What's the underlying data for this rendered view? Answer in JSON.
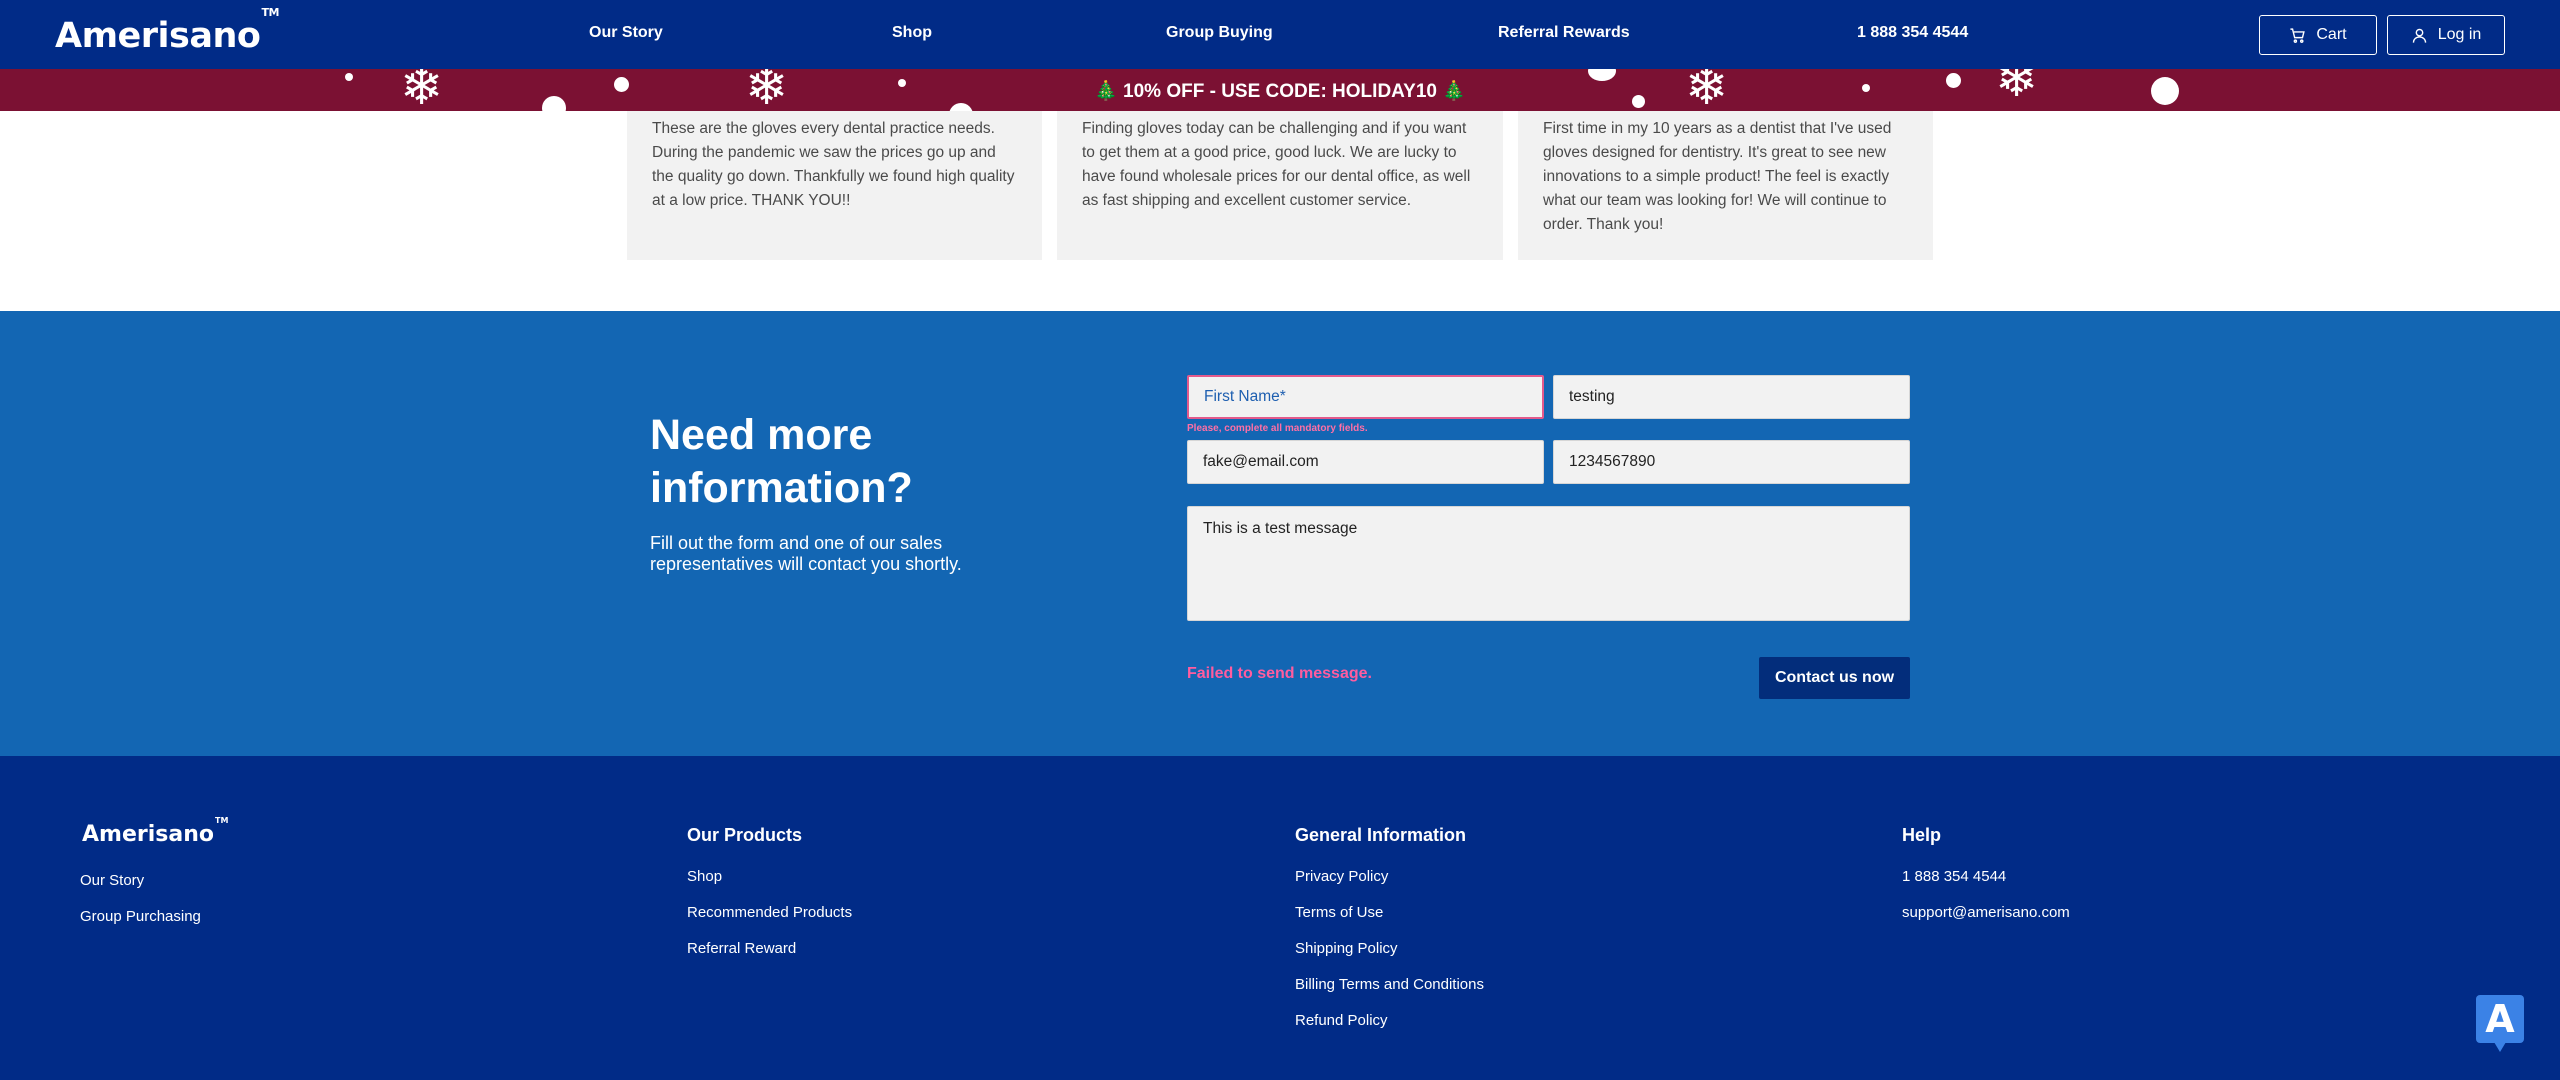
{
  "header": {
    "logo": "Amerisano",
    "logo_tm": "TM",
    "nav": [
      "Our Story",
      "Shop",
      "Group Buying",
      "Referral Rewards",
      "1 888 354 4544"
    ],
    "cart_label": "Cart",
    "login_label": "Log in"
  },
  "promo": {
    "text": "🎄 10% OFF - USE CODE: HOLIDAY10 🎄"
  },
  "testimonials": [
    {
      "text": "These are the gloves every dental practice needs. During the pandemic we saw the prices go up and the quality go down. Thankfully we found high quality at a low price. THANK YOU!!"
    },
    {
      "text": "Finding gloves today can be challenging and if you want to get them at a good price, good luck. We are lucky to have found wholesale prices for our dental office, as well as fast shipping and excellent customer service."
    },
    {
      "text": "First time in my 10 years as a dentist that I've used gloves designed for dentistry. It's great to see new innovations to a simple product! The feel is exactly what our team was looking for! We will continue to order. Thank you!"
    }
  ],
  "contact": {
    "title": "Need more information?",
    "description": "Fill out the form and one of our sales representatives will contact you shortly.",
    "first_name_placeholder": "First Name*",
    "last_name_value": "testing",
    "email_value": "fake@email.com",
    "phone_value": "1234567890",
    "message_value": "This is a test message",
    "error_text": "Please, complete all mandatory fields.",
    "fail_text": "Failed to send message.",
    "submit_label": "Contact us now"
  },
  "footer": {
    "logo": "Amerisano",
    "logo_tm": "TM",
    "col1_links": [
      "Our Story",
      "Group Purchasing"
    ],
    "products_heading": "Our Products",
    "products_links": [
      "Shop",
      "Recommended Products",
      "Referral Reward"
    ],
    "general_heading": "General Information",
    "general_links": [
      "Privacy Policy",
      "Terms of Use",
      "Shipping Policy",
      "Billing Terms and Conditions",
      "Refund Policy"
    ],
    "help_heading": "Help",
    "help_links": [
      "1 888 354 4544",
      "support@amerisano.com"
    ]
  },
  "chat_widget": {
    "letter": "A"
  },
  "colors": {
    "header_bg": "#012b87",
    "promo_bg": "#7b1133",
    "contact_bg": "#1366b3",
    "error_pink": "#ff6fa5",
    "button_bg": "#032d7b"
  },
  "icons": {
    "cart": "cart-icon",
    "user": "user-icon",
    "chat": "chat-icon",
    "snowflake": "snowflake-icon"
  }
}
